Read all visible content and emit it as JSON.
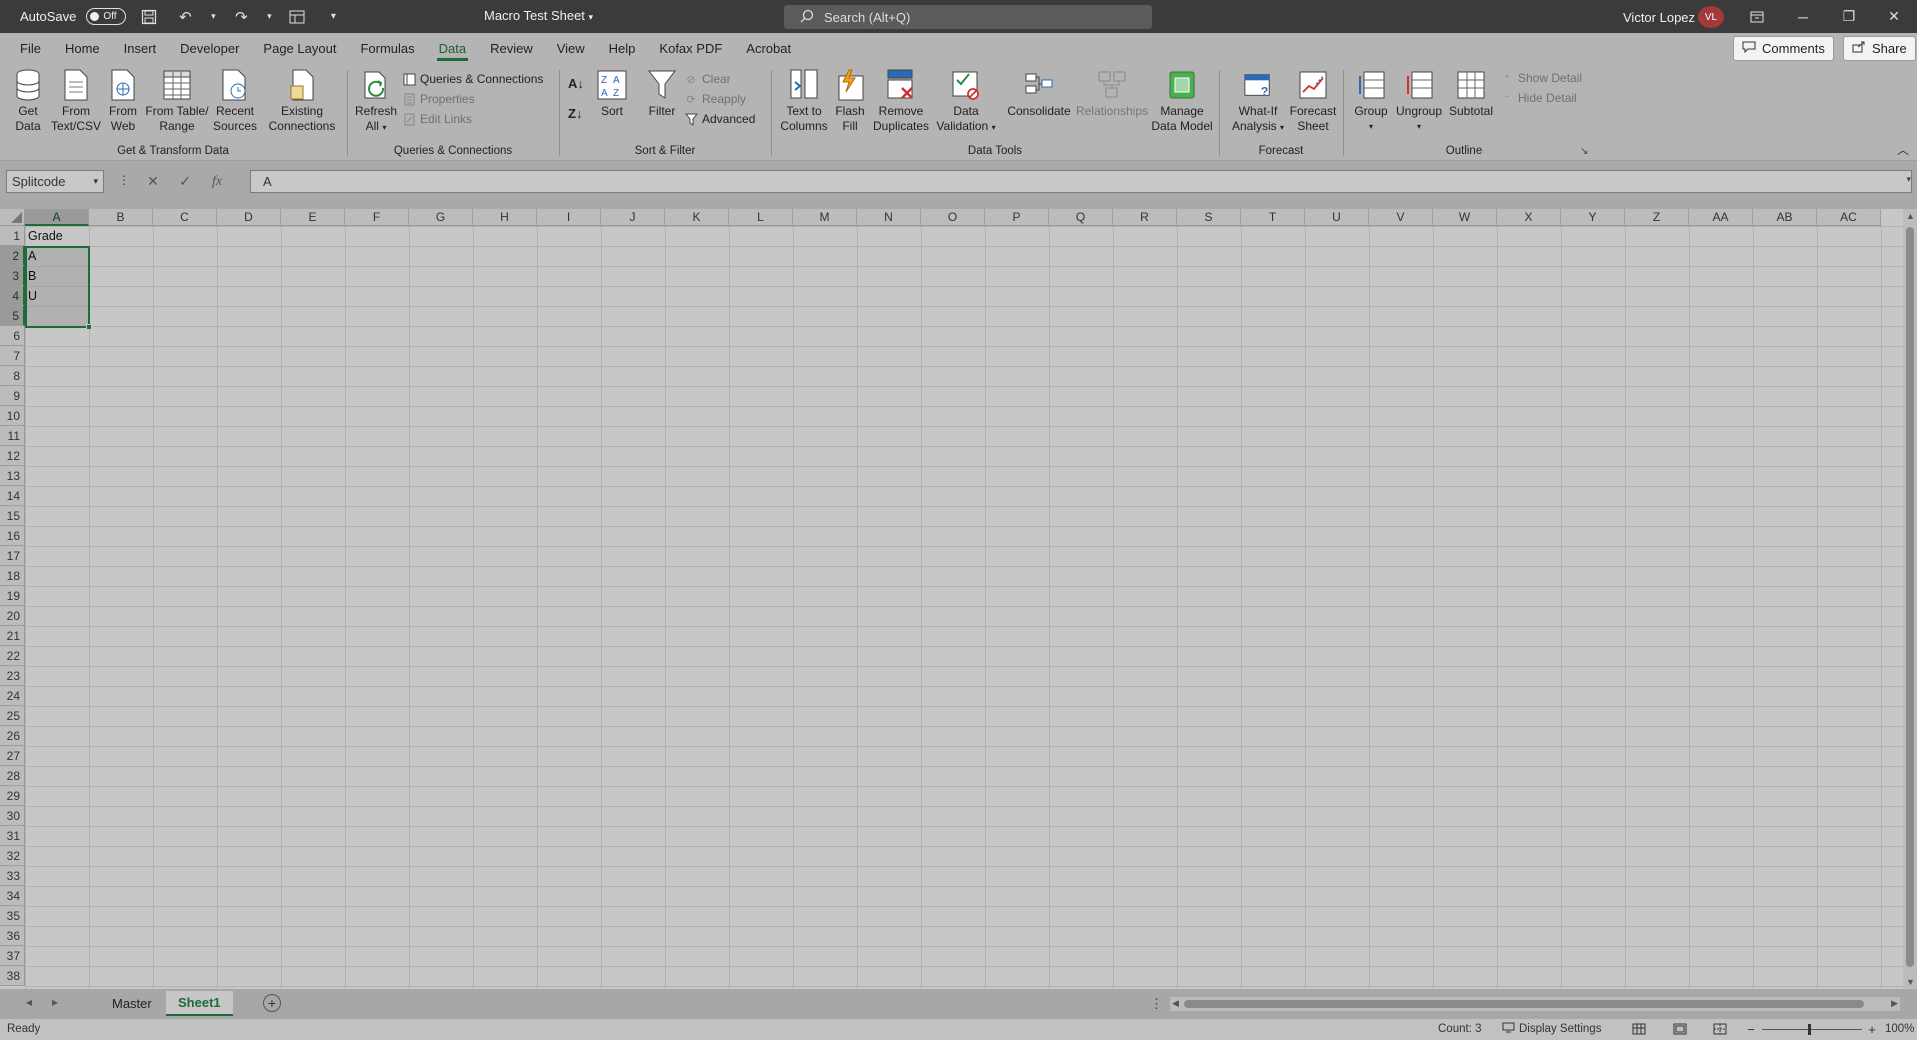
{
  "titlebar": {
    "autosave_label": "AutoSave",
    "autosave_state": "Off",
    "doc_title": "Macro Test Sheet",
    "search_placeholder": "Search (Alt+Q)",
    "user_name": "Victor Lopez",
    "user_initials": "VL"
  },
  "menu": {
    "tabs": [
      "File",
      "Home",
      "Insert",
      "Developer",
      "Page Layout",
      "Formulas",
      "Data",
      "Review",
      "View",
      "Help",
      "Kofax PDF",
      "Acrobat"
    ],
    "active": "Data",
    "comments_label": "Comments",
    "share_label": "Share"
  },
  "ribbon": {
    "get_transform": {
      "label": "Get & Transform Data",
      "get_data_1": "Get",
      "get_data_2": "Data",
      "from_text_1": "From",
      "from_text_2": "Text/CSV",
      "from_web_1": "From",
      "from_web_2": "Web",
      "from_table_1": "From Table/",
      "from_table_2": "Range",
      "recent_1": "Recent",
      "recent_2": "Sources",
      "existing_1": "Existing",
      "existing_2": "Connections"
    },
    "queries": {
      "label": "Queries & Connections",
      "refresh_1": "Refresh",
      "refresh_2": "All",
      "queries_connections": "Queries & Connections",
      "properties": "Properties",
      "edit_links": "Edit Links"
    },
    "sort_filter": {
      "label": "Sort & Filter",
      "sort": "Sort",
      "filter": "Filter",
      "clear": "Clear",
      "reapply": "Reapply",
      "advanced": "Advanced"
    },
    "data_tools": {
      "label": "Data Tools",
      "text_to_1": "Text to",
      "text_to_2": "Columns",
      "flash_1": "Flash",
      "flash_2": "Fill",
      "remove_1": "Remove",
      "remove_2": "Duplicates",
      "validation_1": "Data",
      "validation_2": "Validation",
      "consolidate": "Consolidate",
      "relationships": "Relationships",
      "manage_1": "Manage",
      "manage_2": "Data Model"
    },
    "forecast": {
      "label": "Forecast",
      "whatif_1": "What-If",
      "whatif_2": "Analysis",
      "forecast_1": "Forecast",
      "forecast_2": "Sheet"
    },
    "outline": {
      "label": "Outline",
      "group": "Group",
      "ungroup": "Ungroup",
      "subtotal": "Subtotal",
      "show_detail": "Show Detail",
      "hide_detail": "Hide Detail"
    }
  },
  "formula_bar": {
    "name_box": "Splitcode",
    "cancel_icon": "✕",
    "enter_icon": "✓",
    "fx_icon": "fx",
    "formula": "A"
  },
  "grid": {
    "columns": [
      "A",
      "B",
      "C",
      "D",
      "E",
      "F",
      "G",
      "H",
      "I",
      "J",
      "K",
      "L",
      "M",
      "N",
      "O",
      "P",
      "Q",
      "R",
      "S",
      "T",
      "U",
      "V",
      "W",
      "X",
      "Y",
      "Z",
      "AA",
      "AB",
      "AC"
    ],
    "rows": [
      "1",
      "2",
      "3",
      "4",
      "5",
      "6",
      "7",
      "8",
      "9",
      "10",
      "11",
      "12",
      "13",
      "14",
      "15",
      "16",
      "17",
      "18",
      "19",
      "20",
      "21",
      "22",
      "23",
      "24",
      "25",
      "26",
      "27",
      "28",
      "29",
      "30",
      "31",
      "32",
      "33",
      "34",
      "35",
      "36",
      "37",
      "38"
    ],
    "cells": {
      "A1": "Grade",
      "A2": "A",
      "A3": "B",
      "A4": "U"
    },
    "selection": "A2:A5"
  },
  "sheets": {
    "tabs": [
      "Master",
      "Sheet1"
    ],
    "active": "Sheet1"
  },
  "status": {
    "ready": "Ready",
    "count": "Count: 3",
    "display_settings": "Display Settings",
    "zoom": "100%",
    "zoom_level_percent": 100
  },
  "colors": {
    "accent_green": "#1e6b37",
    "titlebar": "#3b3b3b",
    "ribbon": "#b4b4b4"
  }
}
